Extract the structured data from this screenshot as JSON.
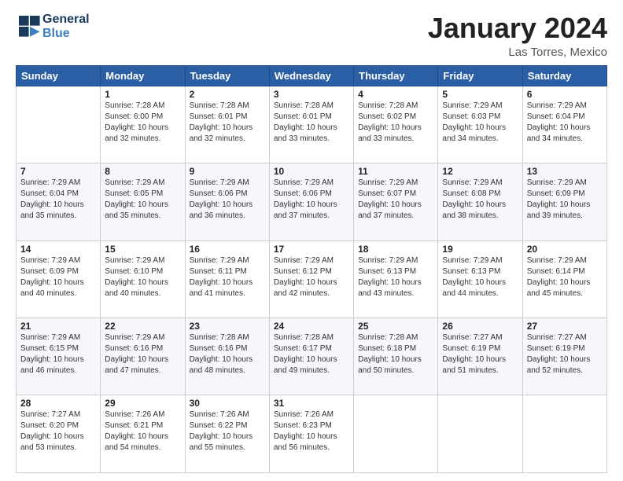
{
  "logo": {
    "line1": "General",
    "line2": "Blue",
    "icon": "▶"
  },
  "title": "January 2024",
  "subtitle": "Las Torres, Mexico",
  "weekdays": [
    "Sunday",
    "Monday",
    "Tuesday",
    "Wednesday",
    "Thursday",
    "Friday",
    "Saturday"
  ],
  "weeks": [
    [
      {
        "day": "",
        "info": ""
      },
      {
        "day": "1",
        "info": "Sunrise: 7:28 AM\nSunset: 6:00 PM\nDaylight: 10 hours\nand 32 minutes."
      },
      {
        "day": "2",
        "info": "Sunrise: 7:28 AM\nSunset: 6:01 PM\nDaylight: 10 hours\nand 32 minutes."
      },
      {
        "day": "3",
        "info": "Sunrise: 7:28 AM\nSunset: 6:01 PM\nDaylight: 10 hours\nand 33 minutes."
      },
      {
        "day": "4",
        "info": "Sunrise: 7:28 AM\nSunset: 6:02 PM\nDaylight: 10 hours\nand 33 minutes."
      },
      {
        "day": "5",
        "info": "Sunrise: 7:29 AM\nSunset: 6:03 PM\nDaylight: 10 hours\nand 34 minutes."
      },
      {
        "day": "6",
        "info": "Sunrise: 7:29 AM\nSunset: 6:04 PM\nDaylight: 10 hours\nand 34 minutes."
      }
    ],
    [
      {
        "day": "7",
        "info": "Sunrise: 7:29 AM\nSunset: 6:04 PM\nDaylight: 10 hours\nand 35 minutes."
      },
      {
        "day": "8",
        "info": "Sunrise: 7:29 AM\nSunset: 6:05 PM\nDaylight: 10 hours\nand 35 minutes."
      },
      {
        "day": "9",
        "info": "Sunrise: 7:29 AM\nSunset: 6:06 PM\nDaylight: 10 hours\nand 36 minutes."
      },
      {
        "day": "10",
        "info": "Sunrise: 7:29 AM\nSunset: 6:06 PM\nDaylight: 10 hours\nand 37 minutes."
      },
      {
        "day": "11",
        "info": "Sunrise: 7:29 AM\nSunset: 6:07 PM\nDaylight: 10 hours\nand 37 minutes."
      },
      {
        "day": "12",
        "info": "Sunrise: 7:29 AM\nSunset: 6:08 PM\nDaylight: 10 hours\nand 38 minutes."
      },
      {
        "day": "13",
        "info": "Sunrise: 7:29 AM\nSunset: 6:09 PM\nDaylight: 10 hours\nand 39 minutes."
      }
    ],
    [
      {
        "day": "14",
        "info": "Sunrise: 7:29 AM\nSunset: 6:09 PM\nDaylight: 10 hours\nand 40 minutes."
      },
      {
        "day": "15",
        "info": "Sunrise: 7:29 AM\nSunset: 6:10 PM\nDaylight: 10 hours\nand 40 minutes."
      },
      {
        "day": "16",
        "info": "Sunrise: 7:29 AM\nSunset: 6:11 PM\nDaylight: 10 hours\nand 41 minutes."
      },
      {
        "day": "17",
        "info": "Sunrise: 7:29 AM\nSunset: 6:12 PM\nDaylight: 10 hours\nand 42 minutes."
      },
      {
        "day": "18",
        "info": "Sunrise: 7:29 AM\nSunset: 6:13 PM\nDaylight: 10 hours\nand 43 minutes."
      },
      {
        "day": "19",
        "info": "Sunrise: 7:29 AM\nSunset: 6:13 PM\nDaylight: 10 hours\nand 44 minutes."
      },
      {
        "day": "20",
        "info": "Sunrise: 7:29 AM\nSunset: 6:14 PM\nDaylight: 10 hours\nand 45 minutes."
      }
    ],
    [
      {
        "day": "21",
        "info": "Sunrise: 7:29 AM\nSunset: 6:15 PM\nDaylight: 10 hours\nand 46 minutes."
      },
      {
        "day": "22",
        "info": "Sunrise: 7:29 AM\nSunset: 6:16 PM\nDaylight: 10 hours\nand 47 minutes."
      },
      {
        "day": "23",
        "info": "Sunrise: 7:28 AM\nSunset: 6:16 PM\nDaylight: 10 hours\nand 48 minutes."
      },
      {
        "day": "24",
        "info": "Sunrise: 7:28 AM\nSunset: 6:17 PM\nDaylight: 10 hours\nand 49 minutes."
      },
      {
        "day": "25",
        "info": "Sunrise: 7:28 AM\nSunset: 6:18 PM\nDaylight: 10 hours\nand 50 minutes."
      },
      {
        "day": "26",
        "info": "Sunrise: 7:27 AM\nSunset: 6:19 PM\nDaylight: 10 hours\nand 51 minutes."
      },
      {
        "day": "27",
        "info": "Sunrise: 7:27 AM\nSunset: 6:19 PM\nDaylight: 10 hours\nand 52 minutes."
      }
    ],
    [
      {
        "day": "28",
        "info": "Sunrise: 7:27 AM\nSunset: 6:20 PM\nDaylight: 10 hours\nand 53 minutes."
      },
      {
        "day": "29",
        "info": "Sunrise: 7:26 AM\nSunset: 6:21 PM\nDaylight: 10 hours\nand 54 minutes."
      },
      {
        "day": "30",
        "info": "Sunrise: 7:26 AM\nSunset: 6:22 PM\nDaylight: 10 hours\nand 55 minutes."
      },
      {
        "day": "31",
        "info": "Sunrise: 7:26 AM\nSunset: 6:23 PM\nDaylight: 10 hours\nand 56 minutes."
      },
      {
        "day": "",
        "info": ""
      },
      {
        "day": "",
        "info": ""
      },
      {
        "day": "",
        "info": ""
      }
    ]
  ]
}
